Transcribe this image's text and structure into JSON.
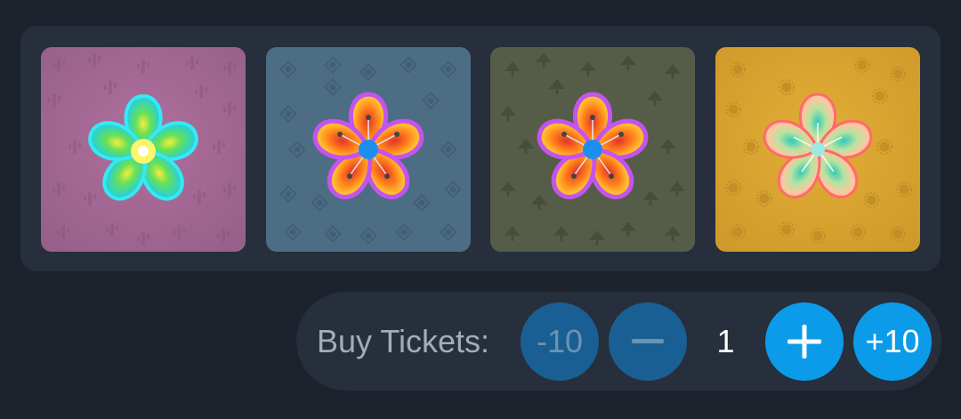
{
  "tiles": [
    {
      "name": "pink",
      "bg": "#a0658e",
      "pattern": "cactus"
    },
    {
      "name": "blue",
      "bg": "#4d6d84",
      "pattern": "knot"
    },
    {
      "name": "olive",
      "bg": "#555d49",
      "pattern": "tree"
    },
    {
      "name": "gold",
      "bg": "#d4a02e",
      "pattern": "sun"
    }
  ],
  "buy": {
    "label": "Buy Tickets:",
    "minus10_label": "-10",
    "minus_icon": "minus-icon",
    "quantity": "1",
    "plus_icon": "plus-icon",
    "plus10_label": "+10"
  },
  "colors": {
    "button_dim": "#1a5f93",
    "button_bright": "#0b9be8"
  }
}
